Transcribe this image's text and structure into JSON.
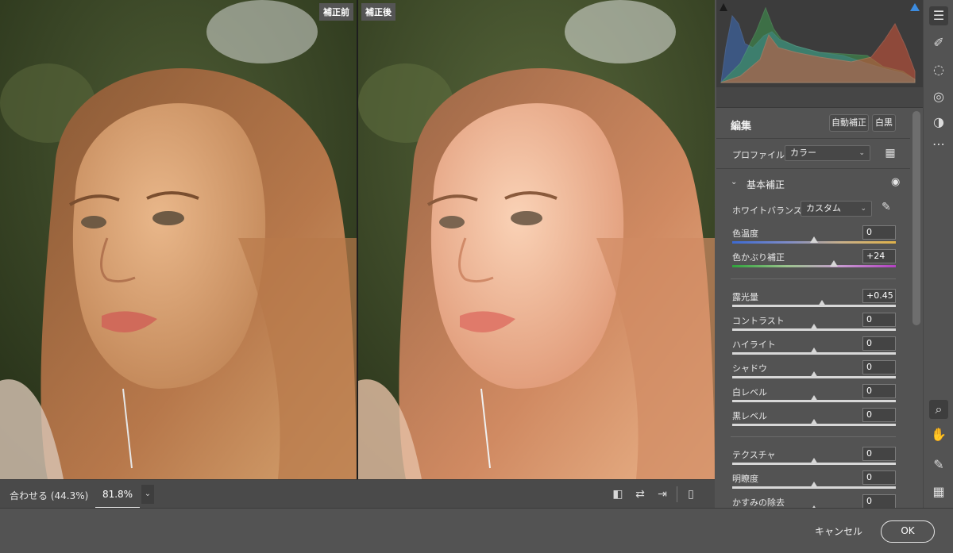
{
  "preview": {
    "before_label": "補正前",
    "after_label": "補正後"
  },
  "view_bar": {
    "zoom_fit": "合わせる (44.3%)",
    "zoom_value": "81.8%"
  },
  "edit": {
    "title": "編集",
    "auto_button": "自動補正",
    "bw_button": "白黒",
    "profile_label": "プロファイル",
    "profile_value": "カラー"
  },
  "basic": {
    "section_title": "基本補正",
    "white_balance_label": "ホワイトバランス",
    "white_balance_value": "カスタム",
    "sliders": [
      {
        "label": "色温度",
        "value": "0",
        "level": 0.5
      },
      {
        "label": "色かぶり補正",
        "value": "+24",
        "level": 0.62
      },
      {
        "label": "露光量",
        "value": "+0.45",
        "level": 0.55
      },
      {
        "label": "コントラスト",
        "value": "0",
        "level": 0.5
      },
      {
        "label": "ハイライト",
        "value": "0",
        "level": 0.5
      },
      {
        "label": "シャドウ",
        "value": "0",
        "level": 0.5
      },
      {
        "label": "白レベル",
        "value": "0",
        "level": 0.5
      },
      {
        "label": "黒レベル",
        "value": "0",
        "level": 0.5
      },
      {
        "label": "テクスチャ",
        "value": "0",
        "level": 0.5
      },
      {
        "label": "明瞭度",
        "value": "0",
        "level": 0.5
      },
      {
        "label": "かすみの除去",
        "value": "0",
        "level": 0.5
      }
    ]
  },
  "footer": {
    "cancel_label": "キャンセル",
    "ok_label": "OK"
  },
  "colors": {
    "hist_red": "#e0573a",
    "hist_green": "#3fae54",
    "hist_blue": "#3c78d8",
    "panel_bg": "#535353"
  }
}
